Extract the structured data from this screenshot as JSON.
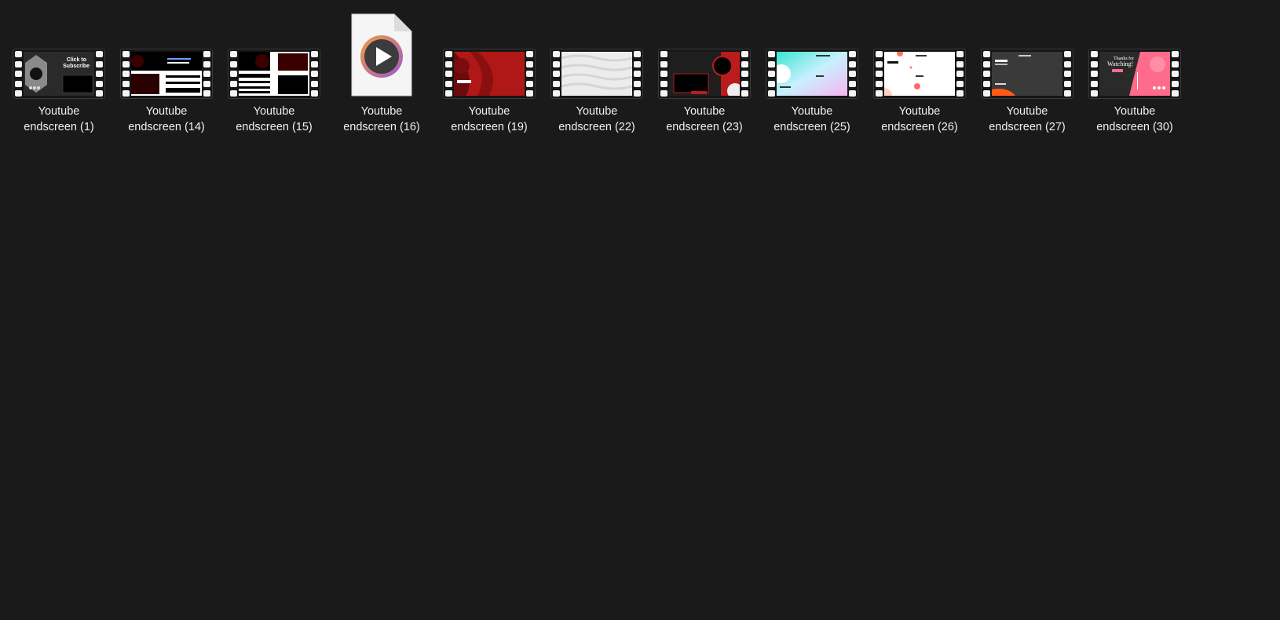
{
  "files": [
    {
      "id": "yt1",
      "line1": "Youtube",
      "line2": "endscreen (1)",
      "kind": "video",
      "theme": "dark-hex"
    },
    {
      "id": "yt14",
      "line1": "Youtube",
      "line2": "endscreen (14)",
      "kind": "video",
      "theme": "black-white-red"
    },
    {
      "id": "yt15",
      "line1": "Youtube",
      "line2": "endscreen (15)",
      "kind": "video",
      "theme": "white-stripes"
    },
    {
      "id": "yt16",
      "line1": "Youtube",
      "line2": "endscreen (16)",
      "kind": "media-file",
      "theme": "play-icon"
    },
    {
      "id": "yt19",
      "line1": "Youtube",
      "line2": "endscreen (19)",
      "kind": "video",
      "theme": "red-waves"
    },
    {
      "id": "yt22",
      "line1": "Youtube",
      "line2": "endscreen (22)",
      "kind": "video",
      "theme": "white-waves"
    },
    {
      "id": "yt23",
      "line1": "Youtube",
      "line2": "endscreen (23)",
      "kind": "video",
      "theme": "dark-red"
    },
    {
      "id": "yt25",
      "line1": "Youtube",
      "line2": "endscreen (25)",
      "kind": "video",
      "theme": "holographic"
    },
    {
      "id": "yt26",
      "line1": "Youtube",
      "line2": "endscreen (26)",
      "kind": "video",
      "theme": "white-dots"
    },
    {
      "id": "yt27",
      "line1": "Youtube",
      "line2": "endscreen (27)",
      "kind": "video",
      "theme": "gray-orange"
    },
    {
      "id": "yt30",
      "line1": "Youtube",
      "line2": "endscreen (30)",
      "kind": "video",
      "theme": "dark-pink"
    }
  ],
  "thumb_text": {
    "yt1_line1": "Click to",
    "yt1_line2": "Subscribe",
    "yt30_line1": "Thanks for",
    "yt30_line2": "Watching!"
  },
  "colors": {
    "background": "#1a1a1a",
    "label": "#f0f0f0",
    "play_ring_start": "#f39c3d",
    "play_ring_end": "#9b59d0"
  }
}
